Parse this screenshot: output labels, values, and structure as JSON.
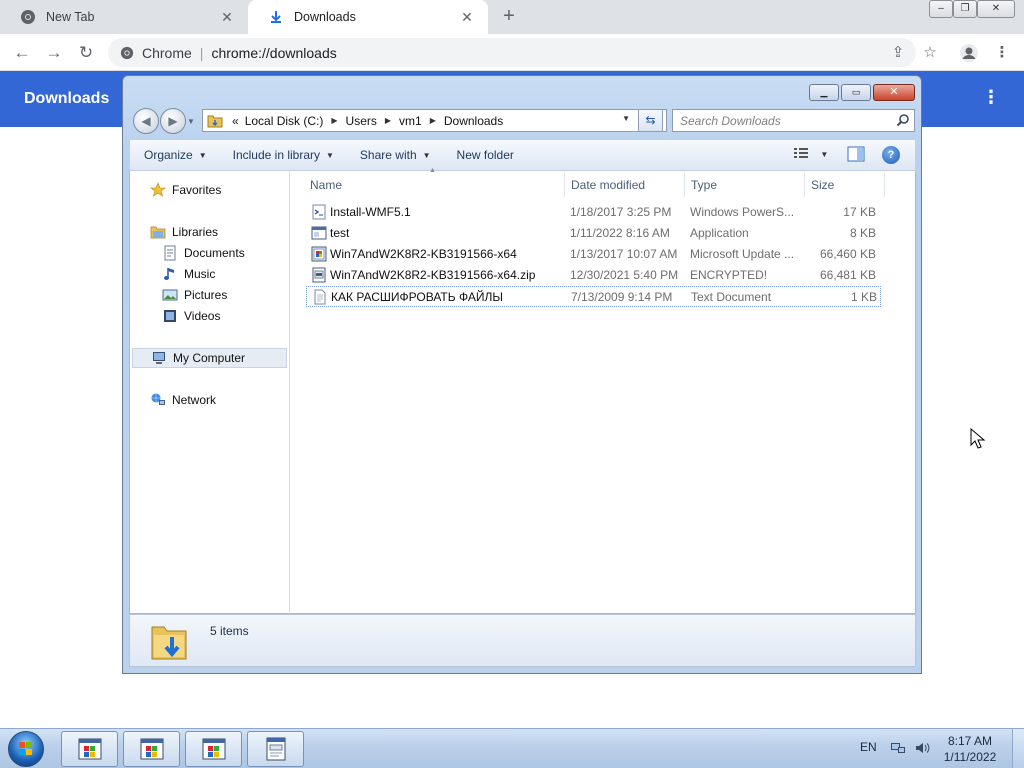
{
  "browser": {
    "tabs": [
      {
        "title": "New Tab",
        "icon": "chrome-icon",
        "active": false
      },
      {
        "title": "Downloads",
        "icon": "download-icon",
        "active": true
      }
    ],
    "new_tab": "+",
    "window_controls": {
      "minimize": "‒",
      "restore": "❐",
      "close": "✕"
    },
    "omnibox": {
      "site_name": "Chrome",
      "separator": "|",
      "url": "chrome://downloads"
    },
    "page_title": "Downloads",
    "menu_icon": "⋮"
  },
  "explorer": {
    "window_controls": {
      "minimize": "▁",
      "maximize": "▭",
      "close": "✕"
    },
    "breadcrumb": {
      "overflow": "«",
      "items": [
        "Local Disk (C:)",
        "Users",
        "vm1",
        "Downloads"
      ]
    },
    "search_placeholder": "Search Downloads",
    "toolbar": {
      "organize": "Organize",
      "include_in_library": "Include in library",
      "share_with": "Share with",
      "new_folder": "New folder",
      "help": "?"
    },
    "nav": {
      "favorites": "Favorites",
      "libraries": "Libraries",
      "documents": "Documents",
      "music": "Music",
      "pictures": "Pictures",
      "videos": "Videos",
      "my_computer": "My Computer",
      "network": "Network"
    },
    "columns": {
      "name": "Name",
      "date": "Date modified",
      "type": "Type",
      "size": "Size"
    },
    "files": [
      {
        "name": "Install-WMF5.1",
        "date": "1/18/2017 3:25 PM",
        "type": "Windows PowerS...",
        "size": "17 KB",
        "icon": "script-icon"
      },
      {
        "name": "test",
        "date": "1/11/2022 8:16 AM",
        "type": "Application",
        "size": "8 KB",
        "icon": "application-icon"
      },
      {
        "name": "Win7AndW2K8R2-KB3191566-x64",
        "date": "1/13/2017 10:07 AM",
        "type": "Microsoft Update ...",
        "size": "66,460 KB",
        "icon": "update-package-icon"
      },
      {
        "name": "Win7AndW2K8R2-KB3191566-x64.zip",
        "date": "12/30/2021 5:40 PM",
        "type": "ENCRYPTED!",
        "size": "66,481 KB",
        "icon": "encrypted-file-icon"
      },
      {
        "name": "КАК РАСШИФРОВАТЬ ФАЙЛЫ",
        "date": "7/13/2009 9:14 PM",
        "type": "Text Document",
        "size": "1 KB",
        "icon": "text-file-icon"
      }
    ],
    "status": "5 items"
  },
  "taskbar": {
    "language": "EN",
    "time": "8:17 AM",
    "date": "1/11/2022",
    "buttons": [
      "app-window-icon",
      "app-window-icon",
      "app-window-icon",
      "text-document-icon"
    ]
  },
  "colors": {
    "downloads_header": "#3367d6",
    "chrome_tabstrip": "#dee1e6",
    "explorer_frame": "#c9dcf3",
    "taskbar": "#bcd1ea"
  }
}
